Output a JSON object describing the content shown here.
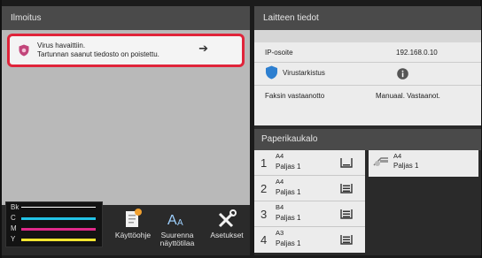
{
  "notice_panel": {
    "title": "Ilmoitus",
    "message_line1": "Virus havaittiin.",
    "message_line2": "Tartunnan saanut tiedosto on poistettu."
  },
  "toner": [
    {
      "label": "Bk",
      "color": "#111111"
    },
    {
      "label": "C",
      "color": "#22c3e6"
    },
    {
      "label": "M",
      "color": "#e02a8a"
    },
    {
      "label": "Y",
      "color": "#f2e530"
    }
  ],
  "tools": {
    "manual_label": "Käyttöohje",
    "zoom_line1": "Suurenna",
    "zoom_line2": "näyttötilaa",
    "settings_label": "Asetukset"
  },
  "device_info": {
    "title": "Laitteen tiedot",
    "ip_key": "IP-osoite",
    "ip_value": "192.168.0.10",
    "virus_key": "Virustarkistus",
    "fax_key": "Faksin vastaanotto",
    "fax_value": "Manuaal. Vastaanot."
  },
  "paper_trays": {
    "title": "Paperikaukalo",
    "trays": [
      {
        "num": "1",
        "size": "A4",
        "type": "Paljas 1"
      },
      {
        "num": "2",
        "size": "A4",
        "type": "Paljas 1"
      },
      {
        "num": "3",
        "size": "B4",
        "type": "Paljas 1"
      },
      {
        "num": "4",
        "size": "A3",
        "type": "Paljas 1"
      }
    ],
    "bypass": {
      "size": "A4",
      "type": "Paljas 1"
    }
  },
  "colors": {
    "alert_border": "#e0243a",
    "shield_pink": "#c2457a",
    "shield_blue": "#2d7fd0"
  }
}
